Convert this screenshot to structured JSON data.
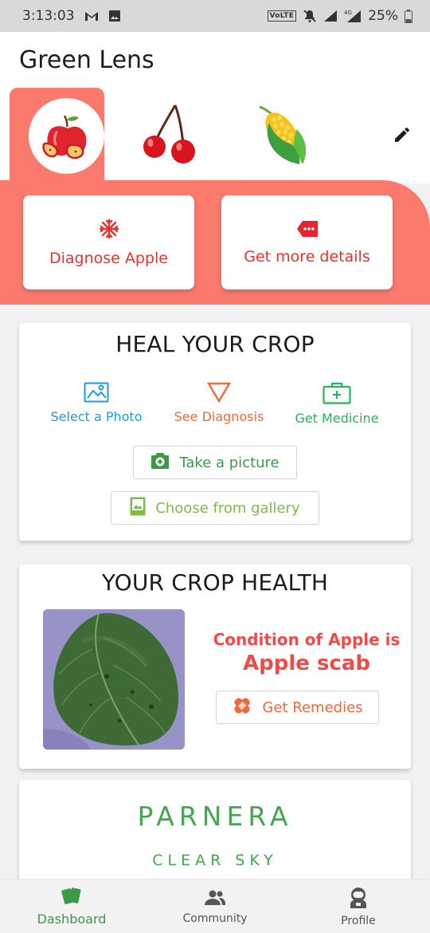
{
  "status_bar": {
    "time": "3:13:03",
    "network_badge": "VoLTE",
    "battery": "25%",
    "icons": [
      "gmail-icon",
      "gallery-icon",
      "mute-icon",
      "signal-icon",
      "signal-4g-icon",
      "battery-icon"
    ]
  },
  "app": {
    "title": "Green Lens"
  },
  "crops": {
    "items": [
      {
        "name": "apple",
        "icon": "apple-icon",
        "selected": true
      },
      {
        "name": "cherry",
        "icon": "cherry-icon",
        "selected": false
      },
      {
        "name": "corn",
        "icon": "corn-icon",
        "selected": false
      }
    ],
    "edit_icon": "pencil-icon"
  },
  "actions": {
    "diagnose_label": "Diagnose Apple",
    "details_label": "Get more details"
  },
  "heal": {
    "title": "HEAL YOUR CROP",
    "steps": [
      {
        "label": "Select a Photo",
        "color": "#1e9be0",
        "icon": "image-icon"
      },
      {
        "label": "See Diagnosis",
        "color": "#f2683b",
        "icon": "triangle-icon"
      },
      {
        "label": "Get Medicine",
        "color": "#27b35a",
        "icon": "medkit-icon"
      }
    ],
    "take_picture_label": "Take a picture",
    "gallery_label": "Choose from gallery"
  },
  "health": {
    "title": "YOUR CROP HEALTH",
    "condition_label": "Condition of Apple is",
    "condition_value": "Apple scab",
    "remedies_label": "Get Remedies"
  },
  "weather": {
    "location": "PARNERA",
    "description": "CLEAR SKY"
  },
  "nav": {
    "items": [
      {
        "label": "Dashboard",
        "icon": "cards-icon",
        "active": true
      },
      {
        "label": "Community",
        "icon": "people-icon",
        "active": false
      },
      {
        "label": "Profile",
        "icon": "astronaut-icon",
        "active": false
      }
    ]
  },
  "colors": {
    "accent": "#fa7a6d",
    "danger_text": "#e0352f",
    "green": "#47a451",
    "light_green": "#7cbd4a"
  }
}
